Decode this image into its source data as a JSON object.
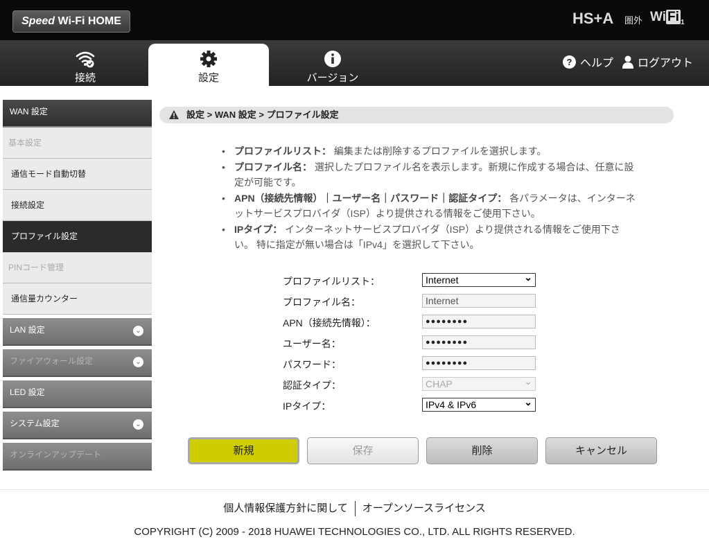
{
  "header": {
    "logo_prefix": "Speed",
    "logo_main": " Wi-Fi HOME",
    "status_mode": "HS+A",
    "status_signal": "圏外",
    "wifi_text": "Wi",
    "wifi_box": "Fi",
    "wifi_sub": "1"
  },
  "nav": {
    "tabs": [
      {
        "label": "接続",
        "icon": "wifi-icon"
      },
      {
        "label": "設定",
        "icon": "gear-icon"
      },
      {
        "label": "バージョン",
        "icon": "info-icon"
      }
    ],
    "help": "ヘルプ",
    "logout": "ログアウト"
  },
  "sidebar": {
    "items": [
      {
        "label": "WAN 設定"
      },
      {
        "label": "基本設定"
      },
      {
        "label": "通信モード自動切替"
      },
      {
        "label": "接続設定"
      },
      {
        "label": "プロファイル設定"
      },
      {
        "label": "PINコード管理"
      },
      {
        "label": "通信量カウンター"
      },
      {
        "label": "LAN 設定"
      },
      {
        "label": "ファイアウォール設定"
      },
      {
        "label": "LED 設定"
      },
      {
        "label": "システム設定"
      },
      {
        "label": "オンラインアップデート"
      }
    ]
  },
  "breadcrumb": "設定 > WAN 設定 > プロファイル設定",
  "description": [
    {
      "term": "プロファイルリスト：",
      "text": "編集または削除するプロファイルを選択します。"
    },
    {
      "term": "プロファイル名：",
      "text": "選択したプロファイル名を表示します。新規に作成する場合は、任意に設定が可能です。"
    },
    {
      "term": "APN（接続先情報）｜ユーザー名｜パスワード｜認証タイプ：",
      "text": "各パラメータは、インターネットサービスプロバイダ（ISP）より提供される情報をご使用下さい。"
    },
    {
      "term": "IPタイプ：",
      "text": "インターネットサービスプロバイダ（ISP）より提供される情報をご使用下さい。 特に指定が無い場合は「IPv4」を選択して下さい。"
    }
  ],
  "form": {
    "profile_list_label": "プロファイルリスト：",
    "profile_list_value": "Internet",
    "profile_name_label": "プロファイル名：",
    "profile_name_value": "Internet",
    "apn_label": "APN（接続先情報）：",
    "apn_value": "●●●●●●●●",
    "user_label": "ユーザー名：",
    "user_value": "●●●●●●●●",
    "password_label": "パスワード：",
    "password_value": "●●●●●●●●",
    "auth_label": "認証タイプ：",
    "auth_value": "CHAP",
    "ip_label": "IPタイプ：",
    "ip_value": "IPv4 & IPv6"
  },
  "buttons": {
    "new": "新規",
    "save": "保存",
    "delete": "削除",
    "cancel": "キャンセル"
  },
  "footer": {
    "privacy": "個人情報保護方針に関して",
    "opensource": "オープンソースライセンス",
    "copyright": "COPYRIGHT (C) 2009 - 2018 HUAWEI TECHNOLOGIES CO., LTD. ALL RIGHTS RESERVED."
  },
  "colors": {
    "accent_button": "#cfcc00",
    "header_bg": "#0a0a0a",
    "sidebar_active": "#2b2b2b"
  }
}
